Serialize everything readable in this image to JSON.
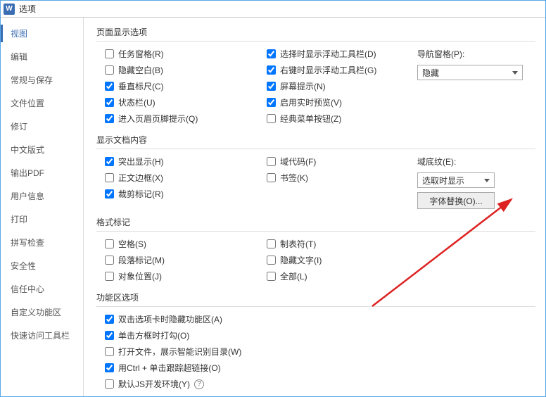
{
  "app_icon_letter": "W",
  "title": "选项",
  "sidebar": [
    {
      "label": "视图",
      "active": true
    },
    {
      "label": "编辑"
    },
    {
      "label": "常规与保存"
    },
    {
      "label": "文件位置"
    },
    {
      "label": "修订"
    },
    {
      "label": "中文版式"
    },
    {
      "label": "输出PDF"
    },
    {
      "label": "用户信息"
    },
    {
      "label": "打印"
    },
    {
      "label": "拼写检查"
    },
    {
      "label": "安全性"
    },
    {
      "label": "信任中心"
    },
    {
      "label": "自定义功能区"
    },
    {
      "label": "快速访问工具栏"
    }
  ],
  "sections": {
    "page_display": {
      "title": "页面显示选项",
      "left": [
        {
          "label": "任务窗格(R)",
          "checked": false
        },
        {
          "label": "隐藏空白(B)",
          "checked": false
        },
        {
          "label": "垂直标尺(C)",
          "checked": true
        },
        {
          "label": "状态栏(U)",
          "checked": true
        },
        {
          "label": "进入页眉页脚提示(Q)",
          "checked": true
        }
      ],
      "mid": [
        {
          "label": "选择时显示浮动工具栏(D)",
          "checked": true
        },
        {
          "label": "右键时显示浮动工具栏(G)",
          "checked": true
        },
        {
          "label": "屏幕提示(N)",
          "checked": true
        },
        {
          "label": "启用实时预览(V)",
          "checked": true
        },
        {
          "label": "经典菜单按钮(Z)",
          "checked": false
        }
      ],
      "nav_label": "导航窗格(P):",
      "nav_value": "隐藏"
    },
    "doc_content": {
      "title": "显示文档内容",
      "left": [
        {
          "label": "突出显示(H)",
          "checked": true
        },
        {
          "label": "正文边框(X)",
          "checked": false
        },
        {
          "label": "裁剪标记(R)",
          "checked": true
        }
      ],
      "mid": [
        {
          "label": "域代码(F)",
          "checked": false
        },
        {
          "label": "书签(K)",
          "checked": false
        }
      ],
      "shade_label": "域底纹(E):",
      "shade_value": "选取时显示",
      "font_sub_btn": "字体替换(O)..."
    },
    "format_marks": {
      "title": "格式标记",
      "left": [
        {
          "label": "空格(S)",
          "checked": false
        },
        {
          "label": "段落标记(M)",
          "checked": false
        },
        {
          "label": "对象位置(J)",
          "checked": false
        }
      ],
      "mid": [
        {
          "label": "制表符(T)",
          "checked": false
        },
        {
          "label": "隐藏文字(I)",
          "checked": false
        },
        {
          "label": "全部(L)",
          "checked": false
        }
      ]
    },
    "ribbon": {
      "title": "功能区选项",
      "items": [
        {
          "label": "双击选项卡时隐藏功能区(A)",
          "checked": true
        },
        {
          "label": "单击方框时打勾(O)",
          "checked": true
        },
        {
          "label": "打开文件，展示智能识别目录(W)",
          "checked": false
        },
        {
          "label": "用Ctrl + 单击跟踪超链接(O)",
          "checked": true
        },
        {
          "label": "默认JS开发环境(Y)",
          "checked": false,
          "help": true
        }
      ]
    }
  }
}
